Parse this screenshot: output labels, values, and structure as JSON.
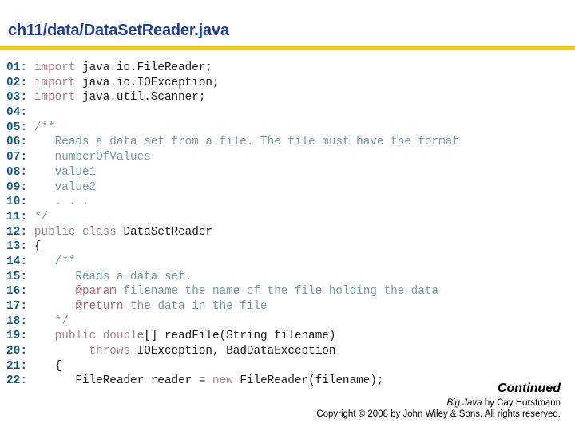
{
  "slide": {
    "title": "ch11/data/DataSetReader.java",
    "rule_color": "#f3c714",
    "title_color": "#1f3fa0"
  },
  "colors": {
    "line_number": "#11577d",
    "keyword": "#ad8090",
    "comment": "#7298ac",
    "javadoc_tag": "#b06878",
    "plain": "#1a1a1a"
  },
  "code": {
    "language": "java",
    "lines": [
      {
        "num": "01:",
        "spans": [
          {
            "t": " import ",
            "c": "kw"
          },
          {
            "t": "java.io.FileReader;",
            "c": "plain"
          }
        ]
      },
      {
        "num": "02:",
        "spans": [
          {
            "t": " import ",
            "c": "kw"
          },
          {
            "t": "java.io.IOException;",
            "c": "plain"
          }
        ]
      },
      {
        "num": "03:",
        "spans": [
          {
            "t": " import ",
            "c": "kw"
          },
          {
            "t": "java.util.Scanner;",
            "c": "plain"
          }
        ]
      },
      {
        "num": "04:",
        "spans": [
          {
            "t": "",
            "c": "plain"
          }
        ]
      },
      {
        "num": "05:",
        "spans": [
          {
            "t": " /**",
            "c": "comment"
          }
        ]
      },
      {
        "num": "06:",
        "spans": [
          {
            "t": "    Reads a data set from a file. The file must have the format",
            "c": "comment"
          }
        ]
      },
      {
        "num": "07:",
        "spans": [
          {
            "t": "    numberOfValues",
            "c": "comment"
          }
        ]
      },
      {
        "num": "08:",
        "spans": [
          {
            "t": "    value1",
            "c": "comment"
          }
        ]
      },
      {
        "num": "09:",
        "spans": [
          {
            "t": "    value2",
            "c": "comment"
          }
        ]
      },
      {
        "num": "10:",
        "spans": [
          {
            "t": "    . . .",
            "c": "comment"
          }
        ]
      },
      {
        "num": "11:",
        "spans": [
          {
            "t": " */",
            "c": "comment"
          }
        ]
      },
      {
        "num": "12:",
        "spans": [
          {
            "t": " public class ",
            "c": "kw"
          },
          {
            "t": "DataSetReader",
            "c": "plain"
          }
        ]
      },
      {
        "num": "13:",
        "spans": [
          {
            "t": " {",
            "c": "plain"
          }
        ]
      },
      {
        "num": "14:",
        "spans": [
          {
            "t": "    /**",
            "c": "comment"
          }
        ]
      },
      {
        "num": "15:",
        "spans": [
          {
            "t": "       Reads a data set.",
            "c": "comment"
          }
        ]
      },
      {
        "num": "16:",
        "spans": [
          {
            "t": "       ",
            "c": "comment"
          },
          {
            "t": "@param",
            "c": "tag"
          },
          {
            "t": " filename the name of the file holding the data",
            "c": "comment"
          }
        ]
      },
      {
        "num": "17:",
        "spans": [
          {
            "t": "       ",
            "c": "comment"
          },
          {
            "t": "@return",
            "c": "tag"
          },
          {
            "t": " the data in the file",
            "c": "comment"
          }
        ]
      },
      {
        "num": "18:",
        "spans": [
          {
            "t": "    */",
            "c": "comment"
          }
        ]
      },
      {
        "num": "19:",
        "spans": [
          {
            "t": "    public double",
            "c": "kw"
          },
          {
            "t": "[] readFile(String filename)",
            "c": "plain"
          }
        ]
      },
      {
        "num": "20:",
        "spans": [
          {
            "t": "         throws ",
            "c": "kw"
          },
          {
            "t": "IOException, BadDataException",
            "c": "plain"
          }
        ]
      },
      {
        "num": "21:",
        "spans": [
          {
            "t": "    {",
            "c": "plain"
          }
        ]
      },
      {
        "num": "22:",
        "spans": [
          {
            "t": "       FileReader reader = ",
            "c": "plain"
          },
          {
            "t": "new",
            "c": "kw"
          },
          {
            "t": " FileReader(filename);",
            "c": "plain"
          }
        ]
      }
    ]
  },
  "footer": {
    "continued": "Continued",
    "book_title": "Big Java",
    "byline_rest": " by Cay Horstmann",
    "copyright": "Copyright © 2008 by John Wiley & Sons.  All rights reserved."
  }
}
